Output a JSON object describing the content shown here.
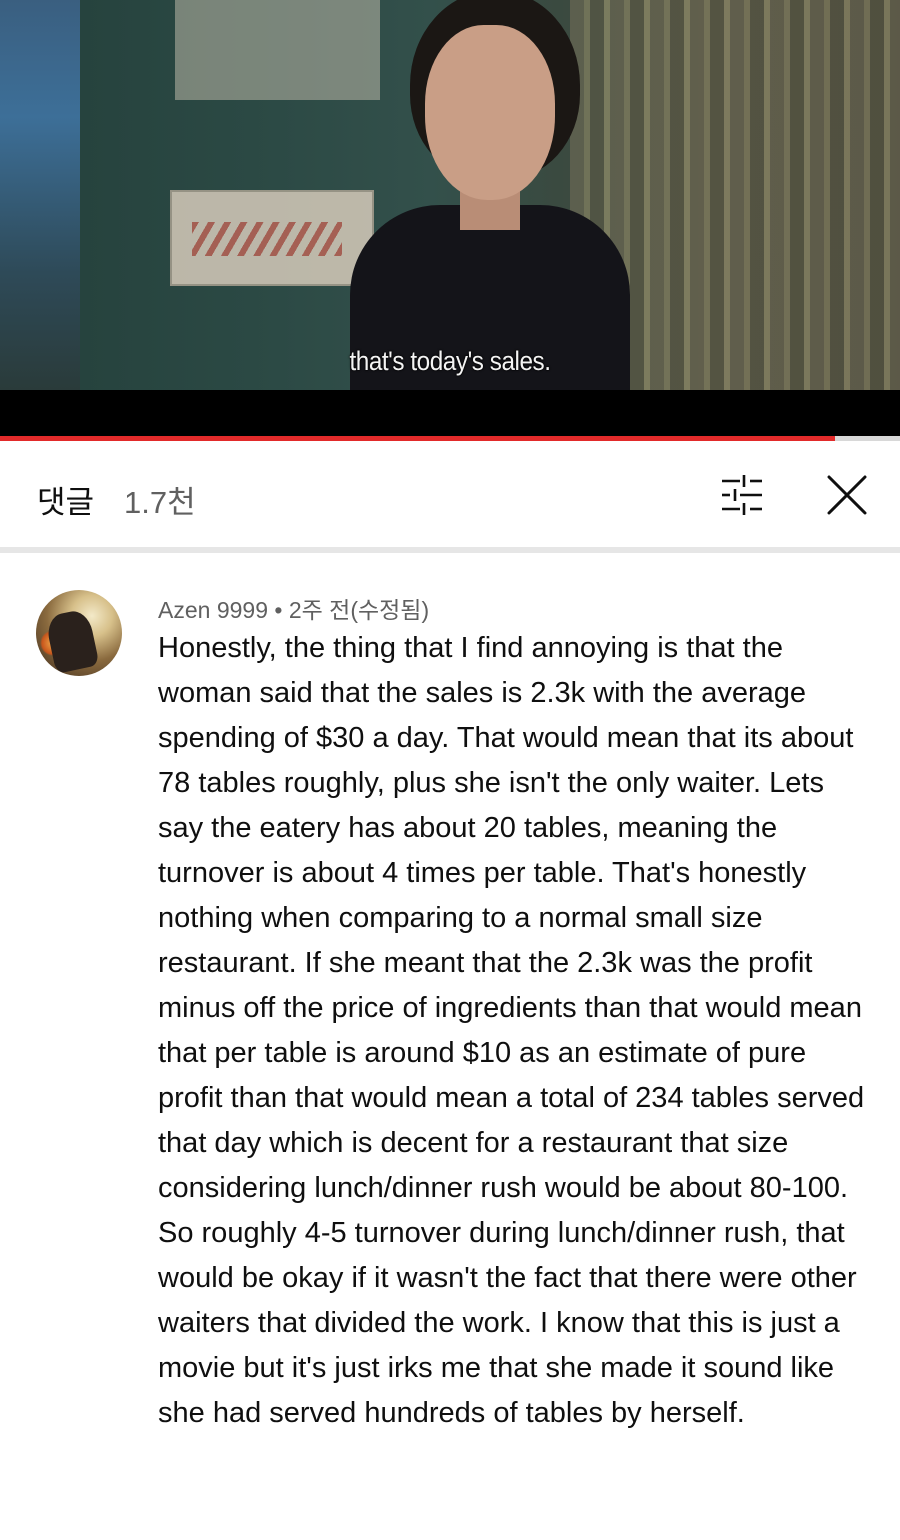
{
  "video": {
    "subtitle": "that's today's sales.",
    "progress_fraction": 0.928
  },
  "comments_header": {
    "title": "댓글",
    "count": "1.7천",
    "sort_icon": "sort-filter-icon",
    "close_icon": "close-icon"
  },
  "comment": {
    "author": "Azen 9999",
    "separator": "•",
    "time": "2주 전(수정됨)",
    "text": "Honestly, the thing that I find annoying is that the woman said that the sales is 2.3k with the average spending of $30 a day. That would mean that its about 78 tables roughly, plus she isn't the only waiter. Lets say the eatery has about 20 tables, meaning the turnover is about 4 times per table. That's honestly nothing when comparing to a normal small size restaurant. If she meant that the 2.3k was the profit minus off the price of ingredients than that would mean that per table is around $10 as an estimate of pure profit than that would mean a total of 234 tables served that day which is decent for a restaurant that size considering lunch/dinner rush would be about 80-100. So roughly 4-5 turnover during lunch/dinner rush, that would be okay if it wasn't the fact that there were other waiters that divided the work. I know that this is just a movie but it's just irks me that she made it sound like she had served hundreds of tables by herself."
  }
}
